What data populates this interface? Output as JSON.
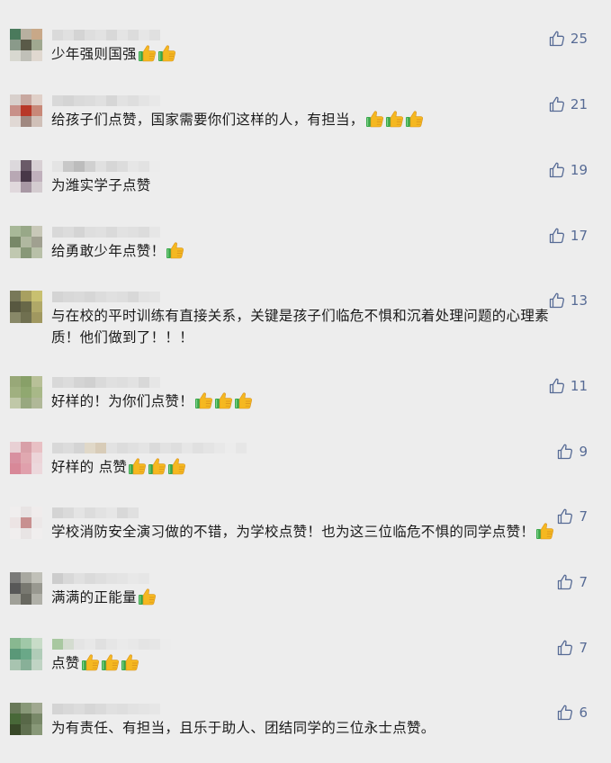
{
  "colors": {
    "background": "#ededed",
    "text": "#1a1a1a",
    "like_accent": "#576b95",
    "emoji_thumb": "#f5b820",
    "emoji_cuff": "#3aa84a"
  },
  "icons": {
    "like": "thumbs-up-outline-icon",
    "emoji": "thumbs-up-emoji-icon"
  },
  "comments": [
    {
      "text": "少年强则国强",
      "emoji_count": 2,
      "likes": "25",
      "avatar": [
        "#4a7a5c",
        "#b8b0a0",
        "#c8a888",
        "#8a9a8a",
        "#5a5a48",
        "#a0a890",
        "#d8d8d0",
        "#c0c0b8",
        "#e0d8d0"
      ],
      "nick": [
        "#dadada",
        "#e0e0e0",
        "#d4d4d4",
        "#dedede",
        "#e2e2e2",
        "#d8d8d8",
        "#e4e4e4",
        "#dcdcdc",
        "#e6e6e6",
        "#e0e0e0"
      ]
    },
    {
      "text": "给孩子们点赞，国家需要你们这样的人，有担当，",
      "emoji_count": 3,
      "likes": "21",
      "avatar": [
        "#d8d0cc",
        "#c8a8a0",
        "#e0d0c8",
        "#c89088",
        "#b83828",
        "#c88878",
        "#e0d8d4",
        "#a08880",
        "#d0c0b8"
      ],
      "nick": [
        "#d8d8d8",
        "#d4d4d4",
        "#dadada",
        "#dcdcdc",
        "#e0e0e0",
        "#d6d6d6",
        "#e2e2e2",
        "#dedede",
        "#e4e4e4",
        "#e8e8e8"
      ]
    },
    {
      "text": "为潍实学子点赞",
      "emoji_count": 0,
      "likes": "19",
      "avatar": [
        "#dcd8dc",
        "#6a5a68",
        "#d8d0d4",
        "#b8a8b4",
        "#483848",
        "#c0b0bc",
        "#e0d8dc",
        "#a898a4",
        "#d4ccd0"
      ],
      "nick": [
        "#e4e4e4",
        "#c8c8c8",
        "#bcbcbc",
        "#d0d0d0",
        "#e0e0e0",
        "#d6d6d6",
        "#dcdcdc",
        "#e6e6e6",
        "#e2e2e2",
        "#ececec"
      ]
    },
    {
      "text": "给勇敢少年点赞！",
      "emoji_count": 1,
      "likes": "17",
      "avatar": [
        "#a8b898",
        "#98a888",
        "#c8c8b8",
        "#788868",
        "#b0b8a0",
        "#a0a090",
        "#c0c8b0",
        "#889878",
        "#b8c0a8"
      ],
      "nick": [
        "#d8d8d8",
        "#dcdcdc",
        "#d4d4d4",
        "#dedede",
        "#e0e0e0",
        "#dadada",
        "#e2e2e2",
        "#e0e0e0",
        "#dcdcdc",
        "#e6e6e6"
      ]
    },
    {
      "text": "与在校的平时训练有直接关系，关键是孩子们临危不惧和沉着处理问题的心理素\n质！他们做到了！！！",
      "emoji_count": 0,
      "likes": "13",
      "avatar": [
        "#787858",
        "#a8a060",
        "#c8c070",
        "#585840",
        "#686848",
        "#b0a868",
        "#888868",
        "#707050",
        "#a09860"
      ],
      "nick": [
        "#d4d4d4",
        "#d8d8d8",
        "#dadada",
        "#d6d6d6",
        "#dcdcdc",
        "#e0e0e0",
        "#dedede",
        "#d8d8d8",
        "#e2e2e2",
        "#e4e4e4"
      ]
    },
    {
      "text": "好样的！为你们点赞！",
      "emoji_count": 3,
      "likes": "11",
      "avatar": [
        "#98a878",
        "#88a068",
        "#b8c098",
        "#a0b080",
        "#90a870",
        "#a8b888",
        "#c0c8a8",
        "#98a880",
        "#b0b898"
      ],
      "nick": [
        "#d8d8d8",
        "#dcdcdc",
        "#d4d4d4",
        "#d0d0d0",
        "#dadada",
        "#e0e0e0",
        "#dedede",
        "#e2e2e2",
        "#d8d8d8",
        "#e6e6e6"
      ]
    },
    {
      "text": "好样的 点赞",
      "emoji_count": 3,
      "likes": "9",
      "avatar": [
        "#e8d0d4",
        "#d8a0a8",
        "#e8c0c4",
        "#d890a0",
        "#e0a8b0",
        "#ecd4d8",
        "#d88898",
        "#e0a0ac",
        "#ecd8dc"
      ],
      "nick": [
        "#d8d8d8",
        "#dcdcdc",
        "#d4d4d4",
        "#e0d8c8",
        "#d8ccb8",
        "#e2e2e2",
        "#dcdcdc",
        "#e0e0e0",
        "#e4e4e4",
        "#dadada",
        "#e2e2e2",
        "#dedede",
        "#e6e6e6",
        "#e0e0e0",
        "#e4e4e4",
        "#e8e8e8",
        "#ececec",
        "#e6e6e6"
      ]
    },
    {
      "text": "学校消防安全演习做的不错，为学校点赞！也为这三位临危不惧的同学点赞！",
      "emoji_count": 1,
      "likes": "7",
      "avatar": [
        "#f0eeee",
        "#e8e4e4",
        "#f0ecec",
        "#ece4e4",
        "#c89090",
        "#ece8e8",
        "#f0eeee",
        "#e8e4e4",
        "#f0eeee"
      ],
      "nick": [
        "#d4d4d4",
        "#dadada",
        "#e4e4e4",
        "#dcdcdc",
        "#e2e2e2",
        "#e6e6e6",
        "#d8d8d8",
        "#e0e0e0"
      ]
    },
    {
      "text": "满满的正能量",
      "emoji_count": 1,
      "likes": "7",
      "avatar": [
        "#7a7a78",
        "#a8a8a0",
        "#c0c0b8",
        "#585858",
        "#787870",
        "#989890",
        "#a0a098",
        "#686860",
        "#b0b0a8"
      ],
      "nick": [
        "#cccccc",
        "#d8d8d8",
        "#e0e0e0",
        "#dadada",
        "#dedede",
        "#e2e2e2",
        "#e4e4e4",
        "#e8e8e8",
        "#e6e6e6"
      ]
    },
    {
      "text": "点赞",
      "emoji_count": 3,
      "likes": "7",
      "avatar": [
        "#88b890",
        "#a0c8a8",
        "#c8dcc8",
        "#5a9878",
        "#6aa888",
        "#b0ccb8",
        "#a8c4b0",
        "#88b098",
        "#c0d4c4"
      ],
      "nick": [
        "#a8c8a0",
        "#d4dcd0",
        "#e4e4e4",
        "#e8e8e8",
        "#e0e0e0",
        "#e6e6e6",
        "#eaeaea",
        "#e8e8e8",
        "#e4e4e4",
        "#e6e6e6",
        "#ececec"
      ]
    },
    {
      "text": "为有责任、有担当，且乐于助人、团结同学的三位永士点赞。",
      "emoji_count": 0,
      "likes": "6",
      "avatar": [
        "#687858",
        "#889878",
        "#a0a890",
        "#486838",
        "#586848",
        "#788868",
        "#384828",
        "#607050",
        "#889878"
      ],
      "nick": [
        "#d4d4d4",
        "#d8d8d8",
        "#dcdcdc",
        "#d6d6d6",
        "#dadada",
        "#e0e0e0",
        "#dedede",
        "#e2e2e2",
        "#e4e4e4",
        "#e6e6e6"
      ]
    }
  ]
}
